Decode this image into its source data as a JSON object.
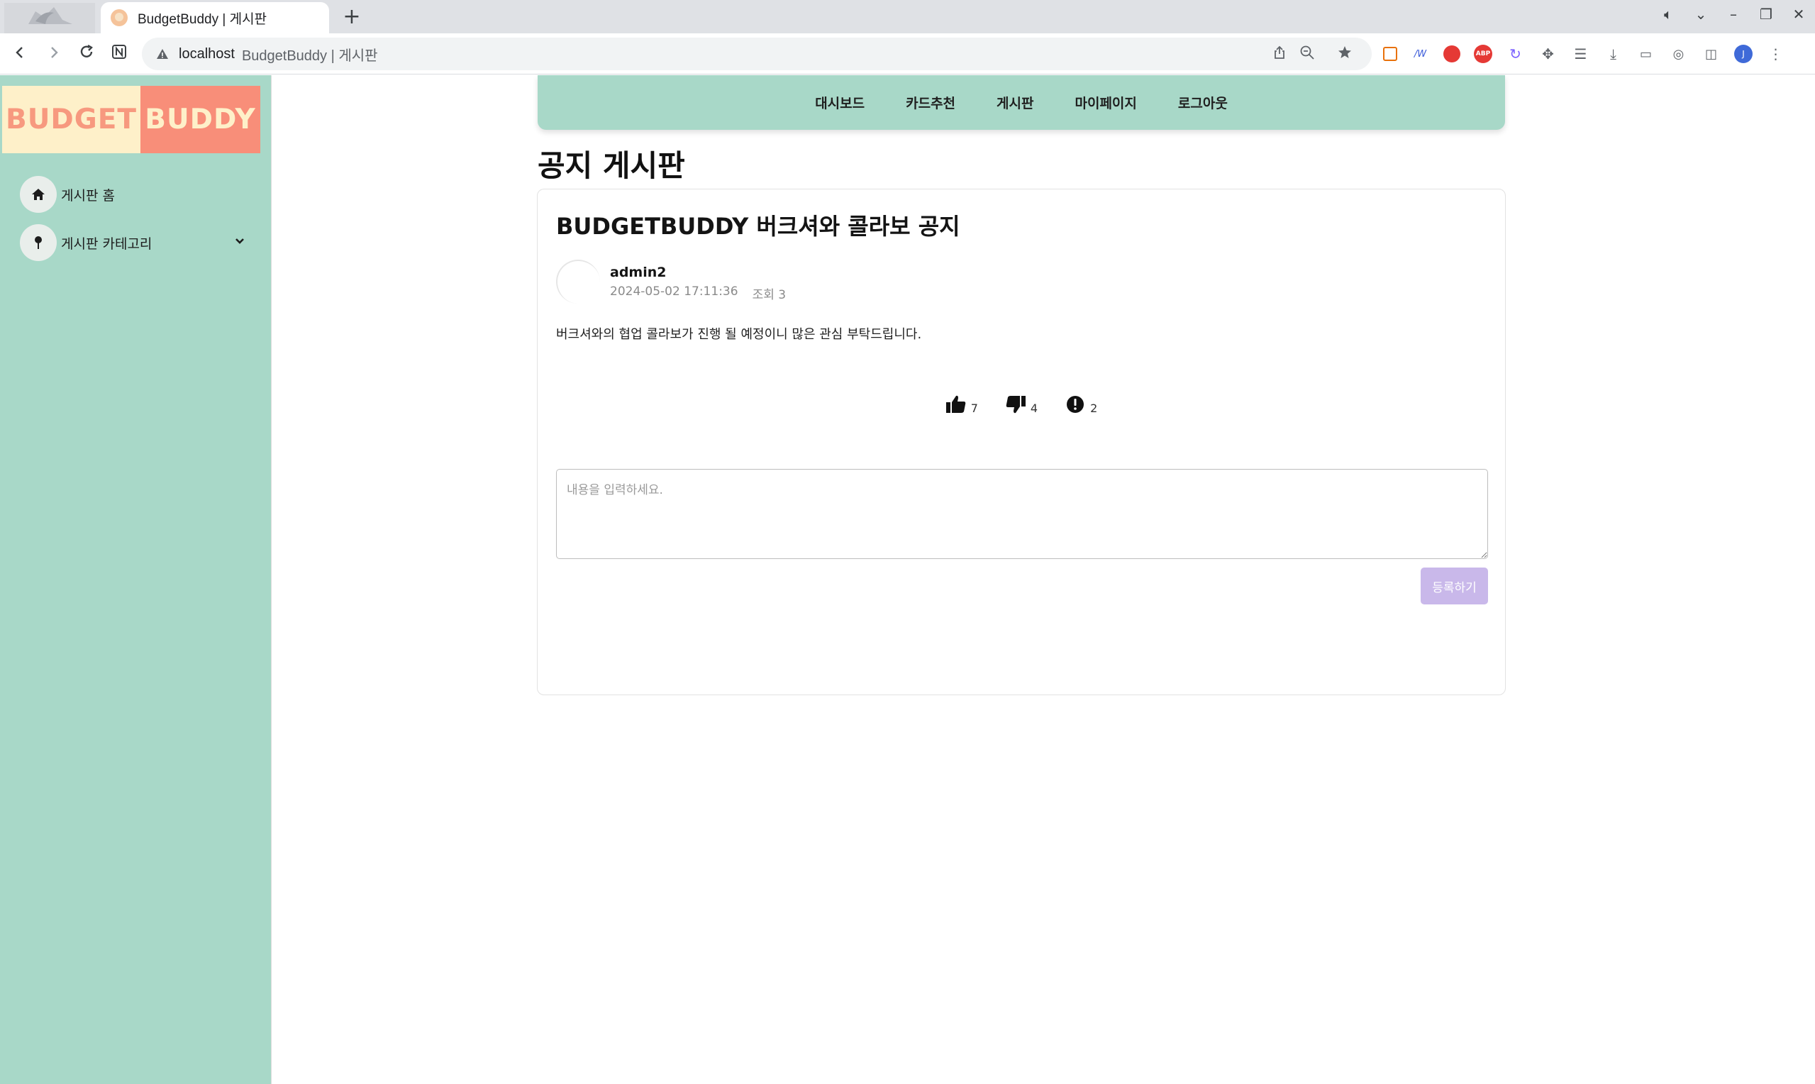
{
  "browser": {
    "tab_title": "BudgetBuddy | 게시판",
    "new_tab": "+",
    "url_host": "localhost",
    "url_title": "BudgetBuddy | 게시판"
  },
  "sidebar": {
    "logo_left": "BUDGET",
    "logo_right": "BUDDY",
    "items": [
      {
        "label": "게시판 홈",
        "icon": "home-icon"
      },
      {
        "label": "게시판 카테고리",
        "icon": "pin-icon"
      }
    ]
  },
  "topnav": {
    "items": [
      "대시보드",
      "카드추천",
      "게시판",
      "마이페이지",
      "로그아웃"
    ]
  },
  "board": {
    "title": "공지 게시판"
  },
  "post": {
    "title": "BUDGETBUDDY 버크셔와 콜라보 공지",
    "author": "admin2",
    "datetime": "2024-05-02 17:11:36",
    "views": "조회 3",
    "content": "버크셔와의 협업 콜라보가 진행 될 예정이니 많은 관심 부탁드립니다.",
    "likes": "7",
    "dislikes": "4",
    "reports": "2"
  },
  "comment": {
    "placeholder": "내용을 입력하세요.",
    "submit_label": "등록하기"
  },
  "colors": {
    "sidebar_bg": "#a8d8c8",
    "nav_bg": "#a8d8c8",
    "logo_left_bg": "#fef0c9",
    "logo_right_bg": "#f88e79",
    "submit_bg": "#c9b8ea"
  }
}
